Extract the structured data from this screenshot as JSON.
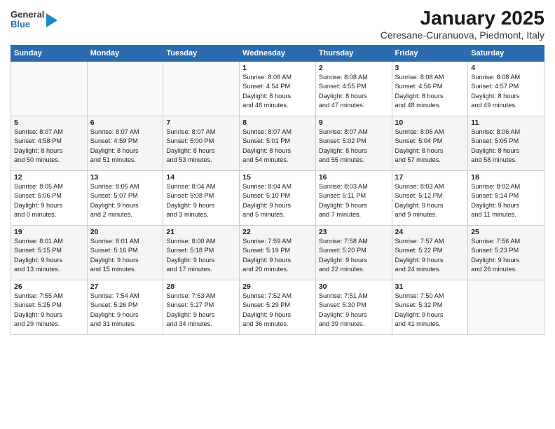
{
  "header": {
    "logo_general": "General",
    "logo_blue": "Blue",
    "title": "January 2025",
    "subtitle": "Ceresane-Curanuova, Piedmont, Italy"
  },
  "days_of_week": [
    "Sunday",
    "Monday",
    "Tuesday",
    "Wednesday",
    "Thursday",
    "Friday",
    "Saturday"
  ],
  "weeks": [
    [
      {
        "day": "",
        "info": ""
      },
      {
        "day": "",
        "info": ""
      },
      {
        "day": "",
        "info": ""
      },
      {
        "day": "1",
        "info": "Sunrise: 8:08 AM\nSunset: 4:54 PM\nDaylight: 8 hours\nand 46 minutes."
      },
      {
        "day": "2",
        "info": "Sunrise: 8:08 AM\nSunset: 4:55 PM\nDaylight: 8 hours\nand 47 minutes."
      },
      {
        "day": "3",
        "info": "Sunrise: 8:08 AM\nSunset: 4:56 PM\nDaylight: 8 hours\nand 48 minutes."
      },
      {
        "day": "4",
        "info": "Sunrise: 8:08 AM\nSunset: 4:57 PM\nDaylight: 8 hours\nand 49 minutes."
      }
    ],
    [
      {
        "day": "5",
        "info": "Sunrise: 8:07 AM\nSunset: 4:58 PM\nDaylight: 8 hours\nand 50 minutes."
      },
      {
        "day": "6",
        "info": "Sunrise: 8:07 AM\nSunset: 4:59 PM\nDaylight: 8 hours\nand 51 minutes."
      },
      {
        "day": "7",
        "info": "Sunrise: 8:07 AM\nSunset: 5:00 PM\nDaylight: 8 hours\nand 53 minutes."
      },
      {
        "day": "8",
        "info": "Sunrise: 8:07 AM\nSunset: 5:01 PM\nDaylight: 8 hours\nand 54 minutes."
      },
      {
        "day": "9",
        "info": "Sunrise: 8:07 AM\nSunset: 5:02 PM\nDaylight: 8 hours\nand 55 minutes."
      },
      {
        "day": "10",
        "info": "Sunrise: 8:06 AM\nSunset: 5:04 PM\nDaylight: 8 hours\nand 57 minutes."
      },
      {
        "day": "11",
        "info": "Sunrise: 8:06 AM\nSunset: 5:05 PM\nDaylight: 8 hours\nand 58 minutes."
      }
    ],
    [
      {
        "day": "12",
        "info": "Sunrise: 8:05 AM\nSunset: 5:06 PM\nDaylight: 9 hours\nand 0 minutes."
      },
      {
        "day": "13",
        "info": "Sunrise: 8:05 AM\nSunset: 5:07 PM\nDaylight: 9 hours\nand 2 minutes."
      },
      {
        "day": "14",
        "info": "Sunrise: 8:04 AM\nSunset: 5:08 PM\nDaylight: 9 hours\nand 3 minutes."
      },
      {
        "day": "15",
        "info": "Sunrise: 8:04 AM\nSunset: 5:10 PM\nDaylight: 9 hours\nand 5 minutes."
      },
      {
        "day": "16",
        "info": "Sunrise: 8:03 AM\nSunset: 5:11 PM\nDaylight: 9 hours\nand 7 minutes."
      },
      {
        "day": "17",
        "info": "Sunrise: 8:03 AM\nSunset: 5:12 PM\nDaylight: 9 hours\nand 9 minutes."
      },
      {
        "day": "18",
        "info": "Sunrise: 8:02 AM\nSunset: 5:14 PM\nDaylight: 9 hours\nand 11 minutes."
      }
    ],
    [
      {
        "day": "19",
        "info": "Sunrise: 8:01 AM\nSunset: 5:15 PM\nDaylight: 9 hours\nand 13 minutes."
      },
      {
        "day": "20",
        "info": "Sunrise: 8:01 AM\nSunset: 5:16 PM\nDaylight: 9 hours\nand 15 minutes."
      },
      {
        "day": "21",
        "info": "Sunrise: 8:00 AM\nSunset: 5:18 PM\nDaylight: 9 hours\nand 17 minutes."
      },
      {
        "day": "22",
        "info": "Sunrise: 7:59 AM\nSunset: 5:19 PM\nDaylight: 9 hours\nand 20 minutes."
      },
      {
        "day": "23",
        "info": "Sunrise: 7:58 AM\nSunset: 5:20 PM\nDaylight: 9 hours\nand 22 minutes."
      },
      {
        "day": "24",
        "info": "Sunrise: 7:57 AM\nSunset: 5:22 PM\nDaylight: 9 hours\nand 24 minutes."
      },
      {
        "day": "25",
        "info": "Sunrise: 7:56 AM\nSunset: 5:23 PM\nDaylight: 9 hours\nand 26 minutes."
      }
    ],
    [
      {
        "day": "26",
        "info": "Sunrise: 7:55 AM\nSunset: 5:25 PM\nDaylight: 9 hours\nand 29 minutes."
      },
      {
        "day": "27",
        "info": "Sunrise: 7:54 AM\nSunset: 5:26 PM\nDaylight: 9 hours\nand 31 minutes."
      },
      {
        "day": "28",
        "info": "Sunrise: 7:53 AM\nSunset: 5:27 PM\nDaylight: 9 hours\nand 34 minutes."
      },
      {
        "day": "29",
        "info": "Sunrise: 7:52 AM\nSunset: 5:29 PM\nDaylight: 9 hours\nand 36 minutes."
      },
      {
        "day": "30",
        "info": "Sunrise: 7:51 AM\nSunset: 5:30 PM\nDaylight: 9 hours\nand 39 minutes."
      },
      {
        "day": "31",
        "info": "Sunrise: 7:50 AM\nSunset: 5:32 PM\nDaylight: 9 hours\nand 41 minutes."
      },
      {
        "day": "",
        "info": ""
      }
    ]
  ]
}
